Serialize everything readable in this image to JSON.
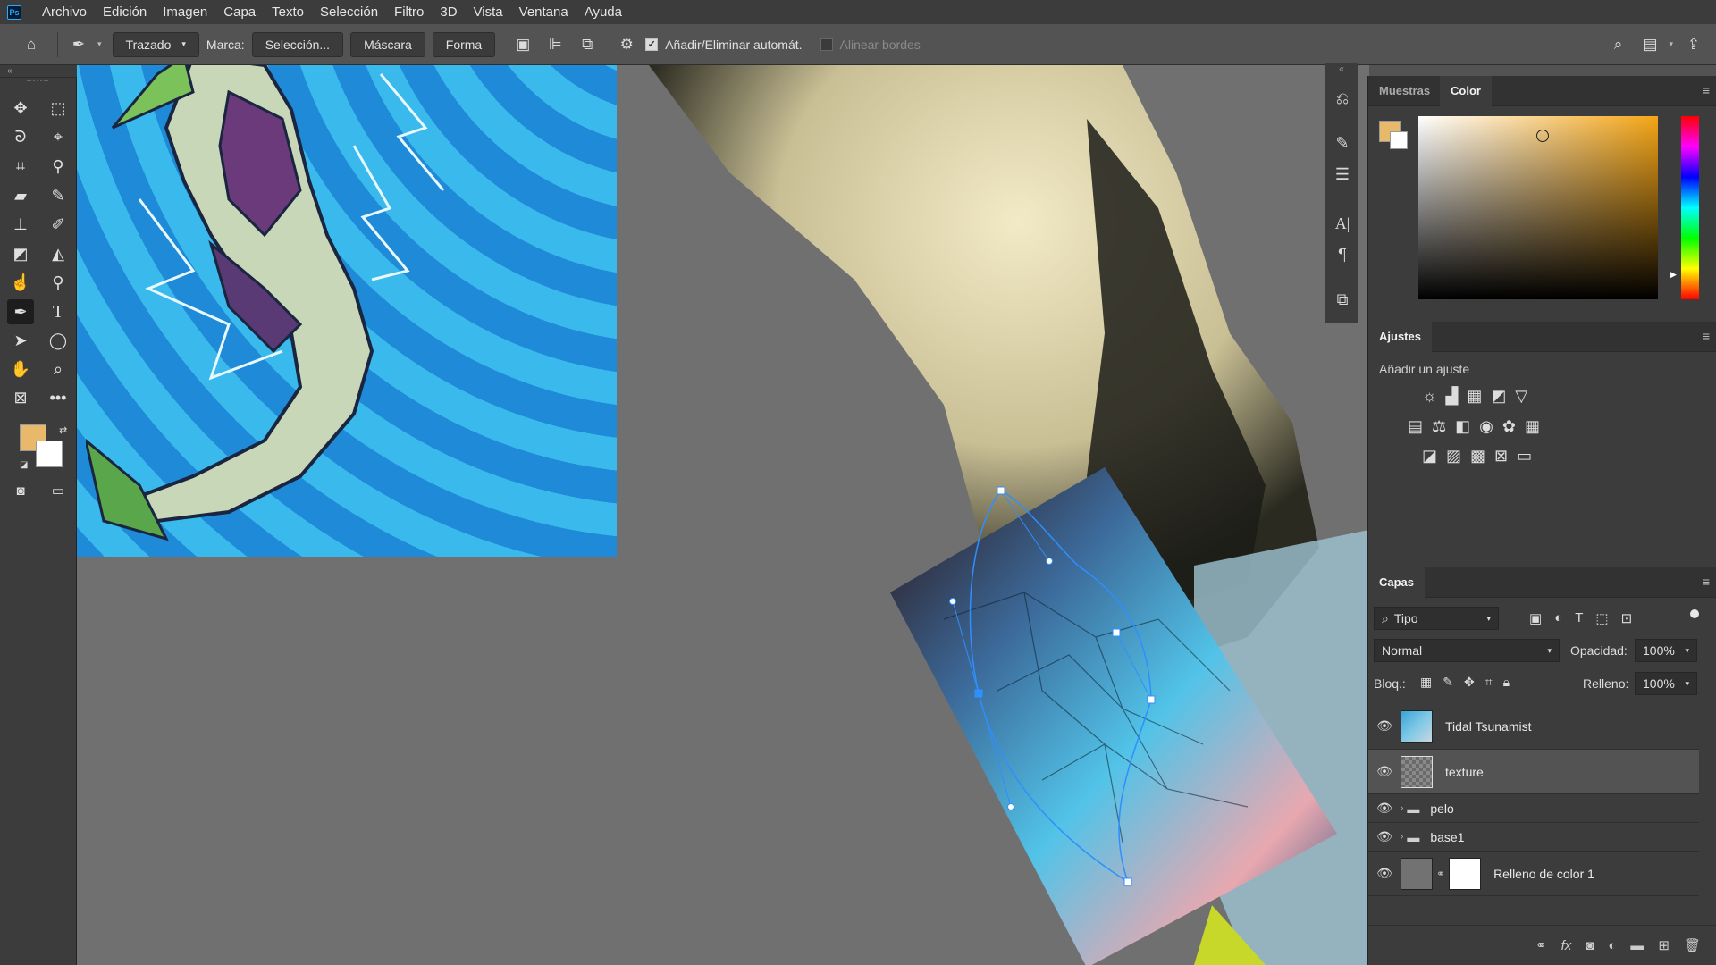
{
  "app": {
    "logo": "Ps"
  },
  "menu": [
    "Archivo",
    "Edición",
    "Imagen",
    "Capa",
    "Texto",
    "Selección",
    "Filtro",
    "3D",
    "Vista",
    "Ventana",
    "Ayuda"
  ],
  "options": {
    "mode": "Trazado",
    "marca_label": "Marca:",
    "seleccion": "Selección...",
    "mascara": "Máscara",
    "forma": "Forma",
    "auto_add": "Añadir/Eliminar automát.",
    "align_edges": "Alinear bordes"
  },
  "colors": {
    "foreground": "#e8b96a",
    "background": "#ffffff",
    "path": "#2e8fff"
  },
  "color_panel": {
    "tabs": [
      "Muestras",
      "Color"
    ],
    "active": "Color"
  },
  "adjustments": {
    "title": "Ajustes",
    "subtitle": "Añadir un ajuste"
  },
  "layers_panel": {
    "title": "Capas",
    "filter": "Tipo",
    "blend": "Normal",
    "opacity_label": "Opacidad:",
    "opacity": "100%",
    "lock_label": "Bloq.:",
    "fill_label": "Relleno:",
    "fill": "100%",
    "layers": [
      {
        "name": "Tidal Tsunamist",
        "type": "smart"
      },
      {
        "name": "texture",
        "type": "smart",
        "selected": true
      },
      {
        "name": "pelo",
        "type": "group"
      },
      {
        "name": "base1",
        "type": "group"
      },
      {
        "name": "Relleno de color 1",
        "type": "fill"
      }
    ]
  }
}
